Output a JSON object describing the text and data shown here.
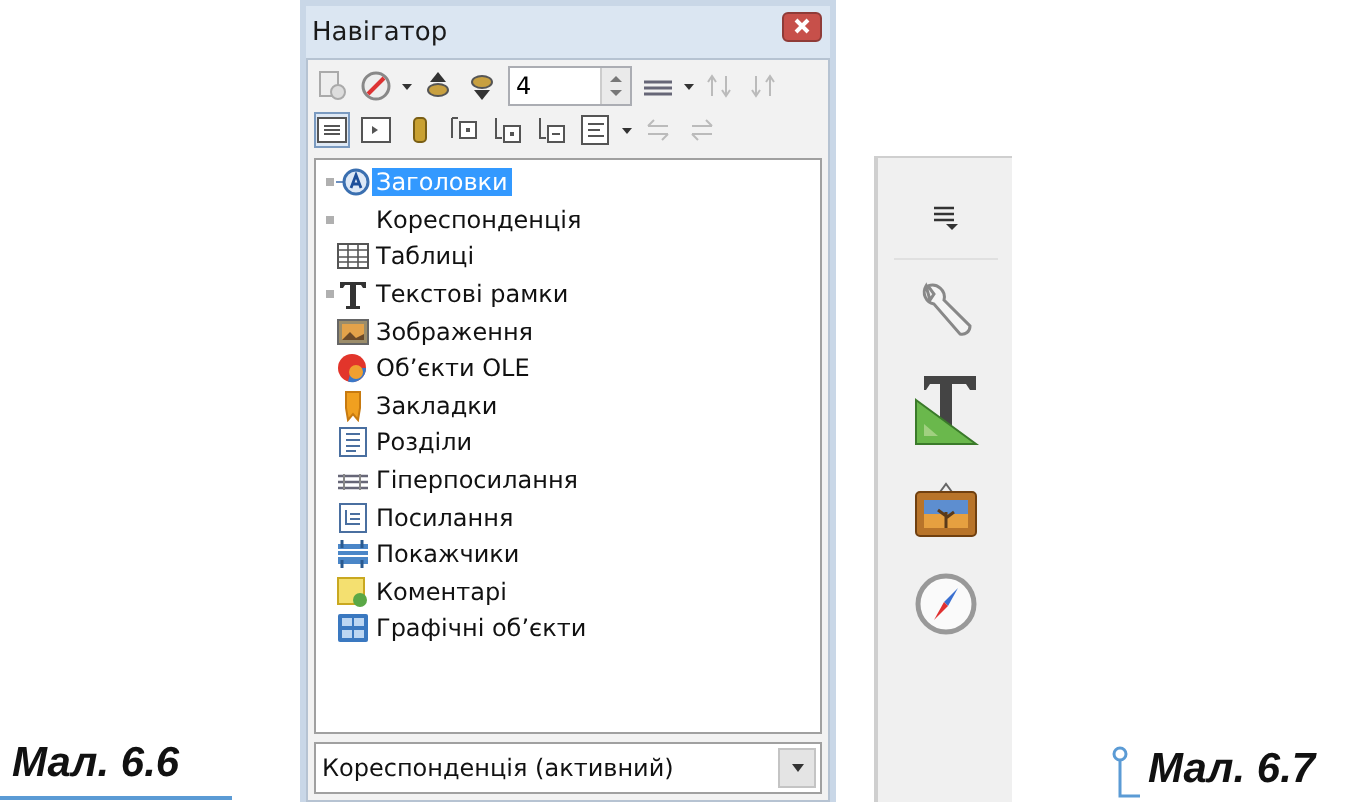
{
  "window": {
    "title": "Навігатор"
  },
  "toolbar": {
    "spin_value": "4"
  },
  "tree": {
    "items": [
      {
        "label": "Заголовки",
        "expander": true,
        "selected": true
      },
      {
        "label": "Кореспонденція",
        "expander": true,
        "selected": false
      },
      {
        "label": "Таблиці",
        "expander": false,
        "selected": false
      },
      {
        "label": "Текстові рамки",
        "expander": true,
        "selected": false
      },
      {
        "label": "Зображення",
        "expander": false,
        "selected": false
      },
      {
        "label": "Об’єкти OLE",
        "expander": false,
        "selected": false
      },
      {
        "label": "Закладки",
        "expander": false,
        "selected": false
      },
      {
        "label": "Розділи",
        "expander": false,
        "selected": false
      },
      {
        "label": "Гіперпосилання",
        "expander": false,
        "selected": false
      },
      {
        "label": "Посилання",
        "expander": false,
        "selected": false
      },
      {
        "label": "Покажчики",
        "expander": false,
        "selected": false
      },
      {
        "label": "Коментарі",
        "expander": false,
        "selected": false
      },
      {
        "label": "Графічні об’єкти",
        "expander": false,
        "selected": false
      }
    ]
  },
  "dropdown": {
    "value": "Кореспонденція (активний)"
  },
  "captions": [
    "Мал. 6.6",
    "Мал. 6.7"
  ]
}
